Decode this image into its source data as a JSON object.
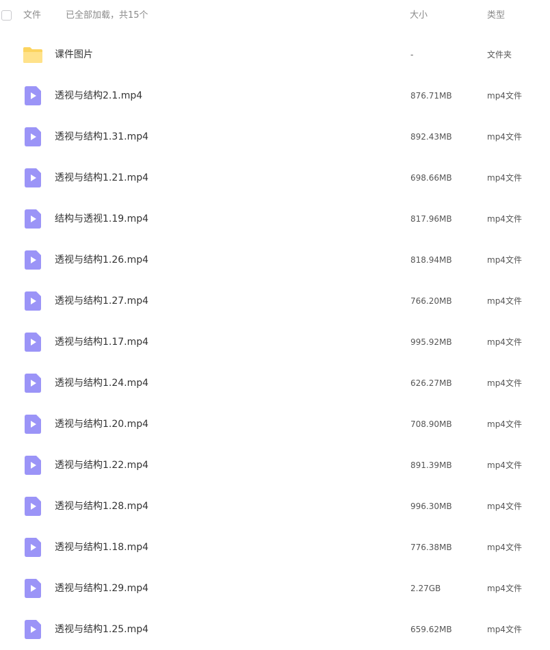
{
  "header": {
    "file_label": "文件",
    "status_text": "已全部加载，共15个",
    "size_label": "大小",
    "type_label": "类型"
  },
  "colors": {
    "folder": "#fcd45f",
    "video": "#9b94f7",
    "text": "#333333",
    "muted": "#8a8a8a"
  },
  "files": [
    {
      "icon": "folder-icon",
      "name": "课件图片",
      "size": "-",
      "type": "文件夹"
    },
    {
      "icon": "video-file-icon",
      "name": "透视与结构2.1.mp4",
      "size": "876.71MB",
      "type": "mp4文件"
    },
    {
      "icon": "video-file-icon",
      "name": "透视与结构1.31.mp4",
      "size": "892.43MB",
      "type": "mp4文件"
    },
    {
      "icon": "video-file-icon",
      "name": "透视与结构1.21.mp4",
      "size": "698.66MB",
      "type": "mp4文件"
    },
    {
      "icon": "video-file-icon",
      "name": "结构与透视1.19.mp4",
      "size": "817.96MB",
      "type": "mp4文件"
    },
    {
      "icon": "video-file-icon",
      "name": "透视与结构1.26.mp4",
      "size": "818.94MB",
      "type": "mp4文件"
    },
    {
      "icon": "video-file-icon",
      "name": "透视与结构1.27.mp4",
      "size": "766.20MB",
      "type": "mp4文件"
    },
    {
      "icon": "video-file-icon",
      "name": "透视与结构1.17.mp4",
      "size": "995.92MB",
      "type": "mp4文件"
    },
    {
      "icon": "video-file-icon",
      "name": "透视与结构1.24.mp4",
      "size": "626.27MB",
      "type": "mp4文件"
    },
    {
      "icon": "video-file-icon",
      "name": "透视与结构1.20.mp4",
      "size": "708.90MB",
      "type": "mp4文件"
    },
    {
      "icon": "video-file-icon",
      "name": "透视与结构1.22.mp4",
      "size": "891.39MB",
      "type": "mp4文件"
    },
    {
      "icon": "video-file-icon",
      "name": "透视与结构1.28.mp4",
      "size": "996.30MB",
      "type": "mp4文件"
    },
    {
      "icon": "video-file-icon",
      "name": "透视与结构1.18.mp4",
      "size": "776.38MB",
      "type": "mp4文件"
    },
    {
      "icon": "video-file-icon",
      "name": "透视与结构1.29.mp4",
      "size": "2.27GB",
      "type": "mp4文件"
    },
    {
      "icon": "video-file-icon",
      "name": "透视与结构1.25.mp4",
      "size": "659.62MB",
      "type": "mp4文件"
    }
  ]
}
